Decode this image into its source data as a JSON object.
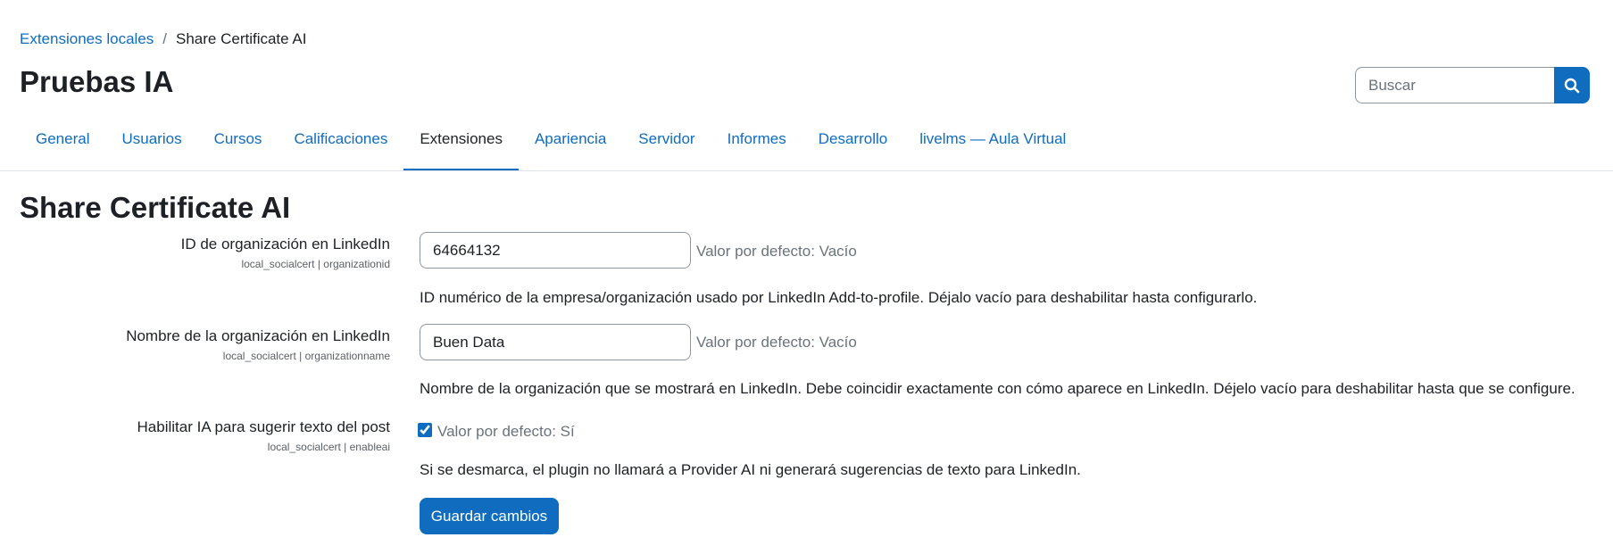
{
  "breadcrumb": {
    "parent": "Extensiones locales",
    "separator": "/",
    "current": "Share Certificate AI"
  },
  "page_title": "Pruebas IA",
  "search": {
    "placeholder": "Buscar",
    "button_icon": "search-icon"
  },
  "nav": {
    "tabs": [
      {
        "label": "General",
        "active": false
      },
      {
        "label": "Usuarios",
        "active": false
      },
      {
        "label": "Cursos",
        "active": false
      },
      {
        "label": "Calificaciones",
        "active": false
      },
      {
        "label": "Extensiones",
        "active": true
      },
      {
        "label": "Apariencia",
        "active": false
      },
      {
        "label": "Servidor",
        "active": false
      },
      {
        "label": "Informes",
        "active": false
      },
      {
        "label": "Desarrollo",
        "active": false
      },
      {
        "label": "livelms — Aula Virtual",
        "active": false
      }
    ]
  },
  "section_title": "Share Certificate AI",
  "settings": [
    {
      "label": "ID de organización en LinkedIn",
      "key": "local_socialcert | organizationid",
      "value": "64664132",
      "default": "Valor por defecto: Vacío",
      "description": "ID numérico de la empresa/organización usado por LinkedIn Add-to-profile. Déjalo vacío para deshabilitar hasta configurarlo."
    },
    {
      "label": "Nombre de la organización en LinkedIn",
      "key": "local_socialcert | organizationname",
      "value": "Buen Data",
      "default": "Valor por defecto: Vacío",
      "description": "Nombre de la organización que se mostrará en LinkedIn. Debe coincidir exactamente con cómo aparece en LinkedIn. Déjelo vacío para deshabilitar hasta que se configure."
    },
    {
      "label": "Habilitar IA para sugerir texto del post",
      "key": "local_socialcert | enableai",
      "checked": true,
      "default": "Valor por defecto: Sí",
      "description": "Si se desmarca, el plugin no llamará a Provider AI ni generará sugerencias de texto para LinkedIn."
    }
  ],
  "save_button": "Guardar cambios",
  "colors": {
    "accent": "#0f6cbf",
    "text": "#1d2125",
    "muted": "#6a737b",
    "border": "#8f959e"
  }
}
